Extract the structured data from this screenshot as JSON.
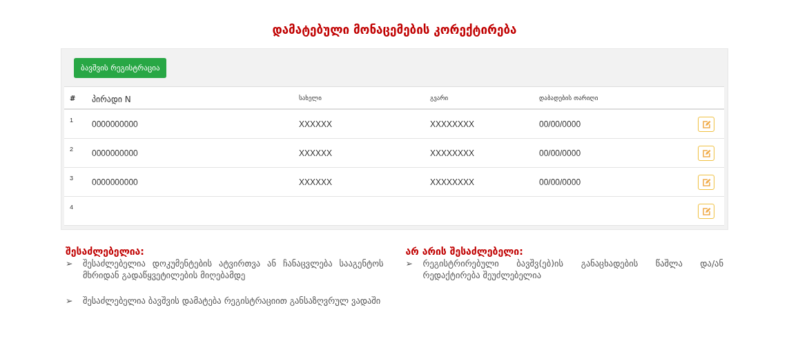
{
  "title": "დამატებული მონაცემების კორექტირება",
  "register_button": "ბავშვის რეგისტრაცია",
  "table": {
    "columns": [
      "#",
      "პირადი N",
      "სახელი",
      "გვარი",
      "დაბადების თარიღი"
    ],
    "rows": [
      {
        "number": "1",
        "personal_n": "0000000000",
        "first_name": "XXXXXX",
        "last_name": "XXXXXXXX",
        "birth_date": "00/00/0000"
      },
      {
        "number": "2",
        "personal_n": "0000000000",
        "first_name": "XXXXXX",
        "last_name": "XXXXXXXX",
        "birth_date": "00/00/0000"
      },
      {
        "number": "3",
        "personal_n": "0000000000",
        "first_name": "XXXXXX",
        "last_name": "XXXXXXXX",
        "birth_date": "00/00/0000"
      },
      {
        "number": "4"
      }
    ]
  },
  "notes": [
    {
      "heading": "შესაძლებელია:",
      "items": [
        {
          "marker": "➢",
          "text": "შესაძლებელია დოკუმენტების ატვირთვა ან ჩანაცვლება სააგენტოს მხრიდან გადაწყვეტილების მიღებამდე"
        },
        {
          "marker": "➢",
          "text": "შესაძლებელია ბავშვის დამატება რეგისტრაციით განსაზღვრულ ვადაში"
        }
      ]
    },
    {
      "heading": "არ არის შესაძლებელი:",
      "items": [
        {
          "marker": "➢",
          "text": "რეგისტრირებული ბავშვ(ებ)ის განაცხადების წაშლა და/ან რედაქტირება შეუძლებელია"
        }
      ]
    }
  ]
}
